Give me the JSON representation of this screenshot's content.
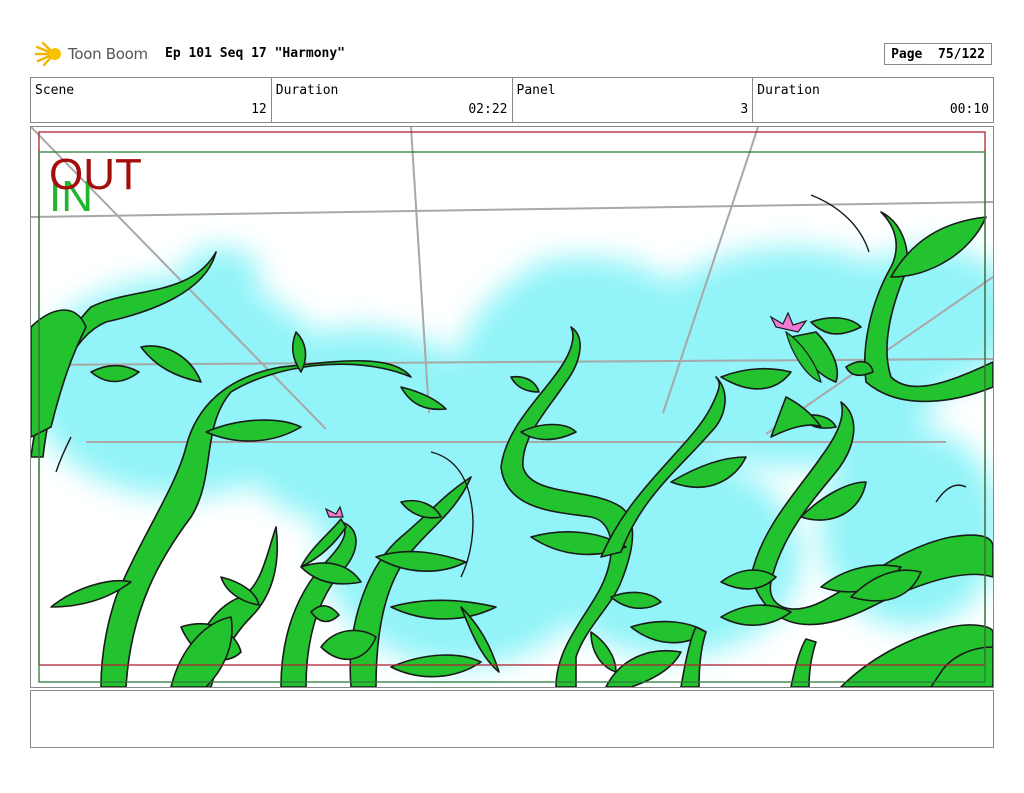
{
  "header": {
    "logo_text": "Toon Boom",
    "title": "Ep 101 Seq 17 \"Harmony\"",
    "page_label": "Page",
    "page_number": "75/122"
  },
  "info": {
    "scene_label": "Scene",
    "scene_value": "12",
    "duration_label": "Duration",
    "duration_value": "02:22",
    "panel_label": "Panel",
    "panel_value": "3",
    "panel_duration_label": "Duration",
    "panel_duration_value": "00:10"
  },
  "panel": {
    "out_label": "OUT",
    "in_label": "IN"
  },
  "colors": {
    "vine_green": "#22c32e",
    "sky_cyan": "#7ff2f7",
    "out_red": "#a50d0d",
    "in_green": "#1fb52c",
    "blossom_pink": "#f07ad6"
  },
  "notes": {
    "text": ""
  }
}
